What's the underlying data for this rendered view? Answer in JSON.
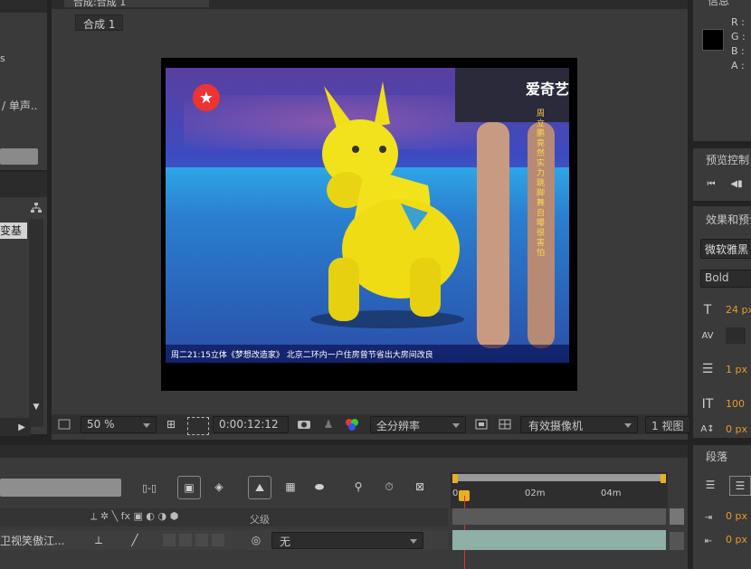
{
  "left_panel": {
    "text_s": "s",
    "text_single": "/ 单声..",
    "effects_item": "变基"
  },
  "comp_viewer": {
    "tab_title": "合成:合成 1",
    "breadcrumb": "合成 1",
    "zoom": "50 %",
    "timecode": "0:00:12:12",
    "resolution": "全分辨率",
    "camera": "有效摄像机",
    "views": "1 视图"
  },
  "video_frame": {
    "watermark": "爱奇艺",
    "caption_vertical": "周立鹏竟然实力跳脚舞自曝很害怕",
    "subtitle": "周二21:15立体《梦想改造家》 北京二环内一户住房曾节省出大房间改良"
  },
  "info_panel": {
    "title": "信息",
    "channels": [
      "R :",
      "G :",
      "B :",
      "A :"
    ]
  },
  "preview_panel": {
    "title": "预览控制"
  },
  "character_panel": {
    "title": "效果和预设",
    "font_name": "微软雅黑",
    "font_style": "Bold",
    "font_size": "24 px",
    "stroke_width": "1 px",
    "vertical_scale": "100",
    "baseline": "0 px"
  },
  "timeline": {
    "layer_name": "卫视笑傲江...",
    "columns_label": "父级",
    "parent_value": "无",
    "ruler_marks": [
      "0s",
      "02m",
      "04m"
    ]
  },
  "paragraph_panel": {
    "title": "段落",
    "indent_left": "0 px",
    "indent_first": "0 px"
  },
  "colors": {
    "panel_bg": "#3a3a3a",
    "app_bg": "#232323",
    "accent_orange": "#e89a2a",
    "playhead_red": "#e03030",
    "workarea_yellow": "#e8b020"
  }
}
